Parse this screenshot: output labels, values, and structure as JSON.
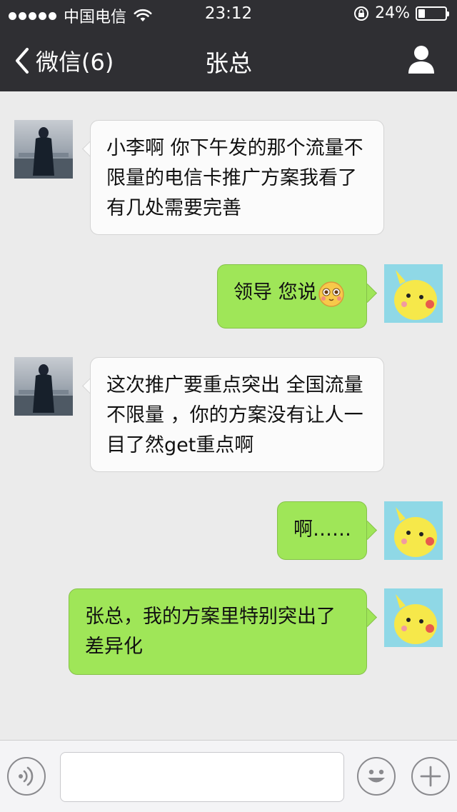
{
  "status": {
    "carrier": "中国电信",
    "time": "23:12",
    "battery": "24%",
    "battery_level": 0.24
  },
  "nav": {
    "back_label": "微信(6)",
    "title": "张总"
  },
  "messages": [
    {
      "side": "left",
      "text": "小李啊 你下午发的那个流量不限量的电信卡推广方案我看了 有几处需要完善"
    },
    {
      "side": "right",
      "text": "领导 您说",
      "emoji": "blushing-face"
    },
    {
      "side": "left",
      "text": "这次推广要重点突出 全国流量不限量 ，你的方案没有让人一目了然get重点啊"
    },
    {
      "side": "right",
      "text": "啊……"
    },
    {
      "side": "right",
      "text": "张总，我的方案里特别突出了差异化"
    }
  ],
  "input": {
    "placeholder": ""
  },
  "icons": [
    "back-chevron-icon",
    "profile-icon",
    "voice-icon",
    "emoji-icon",
    "plus-icon",
    "wifi-icon",
    "lock-icon",
    "battery-icon"
  ],
  "colors": {
    "header": "#2f2f33",
    "background": "#ebebeb",
    "outgoing": "#9fe658",
    "incoming": "#fbfbfb"
  }
}
